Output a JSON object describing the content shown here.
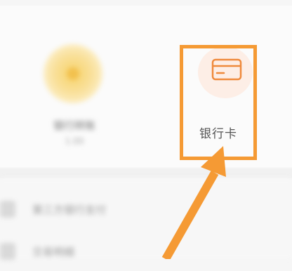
{
  "grid": {
    "item1": {
      "label": "银行转账",
      "sub": "1.00",
      "icon": "coin-icon"
    },
    "item2": {
      "label": "银行卡",
      "icon": "bank-card-icon"
    }
  },
  "list": [
    {
      "label": "第三方银行支付",
      "icon": "list-icon"
    },
    {
      "label": "交易明细",
      "icon": "list-icon"
    }
  ],
  "colors": {
    "accent": "#f59a34",
    "icon_bg": "#fdeee6"
  }
}
